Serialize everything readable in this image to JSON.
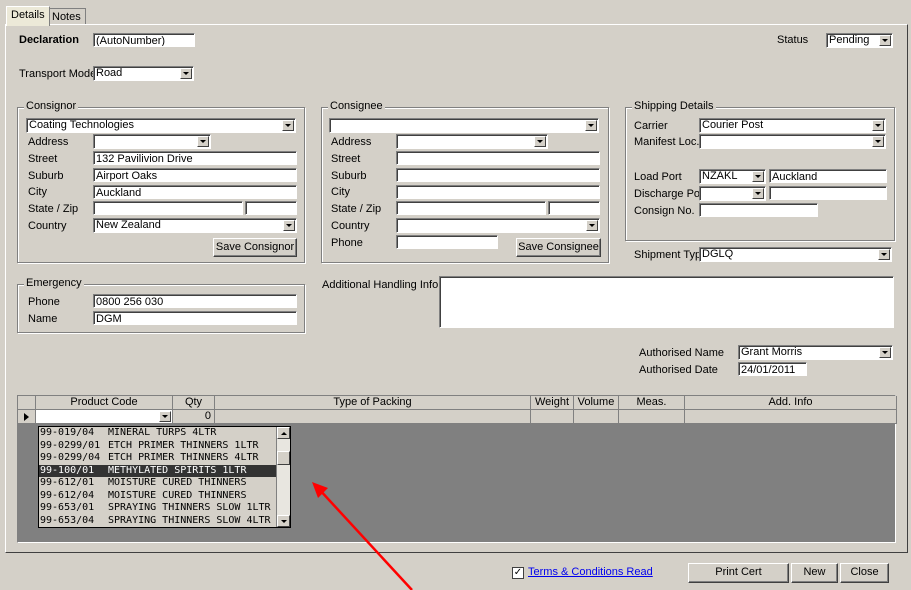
{
  "tabs": [
    "Details",
    "Notes"
  ],
  "declaration": {
    "label": "Declaration",
    "value": "(AutoNumber)"
  },
  "status": {
    "label": "Status",
    "value": "Pending"
  },
  "transport": {
    "label": "Transport Mode",
    "value": "Road"
  },
  "consignor": {
    "title": "Consignor",
    "name": "Coating Technologies",
    "address_label": "Address",
    "address": "",
    "street_label": "Street",
    "street": "132 Pavilivion Drive",
    "suburb_label": "Suburb",
    "suburb": "Airport Oaks",
    "city_label": "City",
    "city": "Auckland",
    "statezip_label": "State / Zip",
    "state": "",
    "zip": "",
    "country_label": "Country",
    "country": "New Zealand",
    "save_label": "Save Consignor"
  },
  "consignee": {
    "title": "Consignee",
    "name": "",
    "address_label": "Address",
    "street_label": "Street",
    "suburb_label": "Suburb",
    "city_label": "City",
    "statezip_label": "State / Zip",
    "country_label": "Country",
    "phone_label": "Phone",
    "save_label": "Save Consignee"
  },
  "shipping": {
    "title": "Shipping Details",
    "carrier_label": "Carrier",
    "carrier": "Courier Post",
    "manifest_label": "Manifest Loc.",
    "manifest": "",
    "load_label": "Load Port",
    "load_code": "NZAKL",
    "load_name": "Auckland",
    "discharge_label": "Discharge Port",
    "discharge_code": "",
    "discharge_name": "",
    "consign_label": "Consign No.",
    "consign": "",
    "shiptype_label": "Shipment Type",
    "shiptype": "DGLQ"
  },
  "emergency": {
    "title": "Emergency",
    "phone_label": "Phone",
    "phone": "0800 256 030",
    "name_label": "Name",
    "name": "DGM"
  },
  "handling": {
    "label": "Additional Handling Info",
    "value": ""
  },
  "authorised": {
    "name_label": "Authorised Name",
    "name": "Grant Morris",
    "date_label": "Authorised Date",
    "date": "24/01/2011"
  },
  "grid": {
    "headers": [
      "Product Code",
      "Qty",
      "Type of Packing",
      "Weight",
      "Volume",
      "Meas.",
      "Add. Info"
    ],
    "qty": "0",
    "dropdown": [
      {
        "code": "99-019/04",
        "desc": "MINERAL TURPS 4LTR"
      },
      {
        "code": "99-0299/01",
        "desc": "ETCH PRIMER THINNERS 1LTR"
      },
      {
        "code": "99-0299/04",
        "desc": "ETCH PRIMER THINNERS 4LTR"
      },
      {
        "code": "99-100/01",
        "desc": "METHYLATED SPIRITS 1LTR"
      },
      {
        "code": "99-612/01",
        "desc": "MOISTURE CURED THINNERS"
      },
      {
        "code": "99-612/04",
        "desc": "MOISTURE CURED THINNERS"
      },
      {
        "code": "99-653/01",
        "desc": "SPRAYING THINNERS SLOW 1LTR"
      },
      {
        "code": "99-653/04",
        "desc": "SPRAYING THINNERS SLOW 4LTR"
      }
    ],
    "selected_index": 3
  },
  "footer": {
    "terms_label": "Terms & Conditions Read",
    "terms_checked": "✓",
    "print_label": "Print Cert",
    "new_label": "New",
    "close_label": "Close"
  },
  "colors": {
    "annotation_arrow": "#ff0000"
  }
}
